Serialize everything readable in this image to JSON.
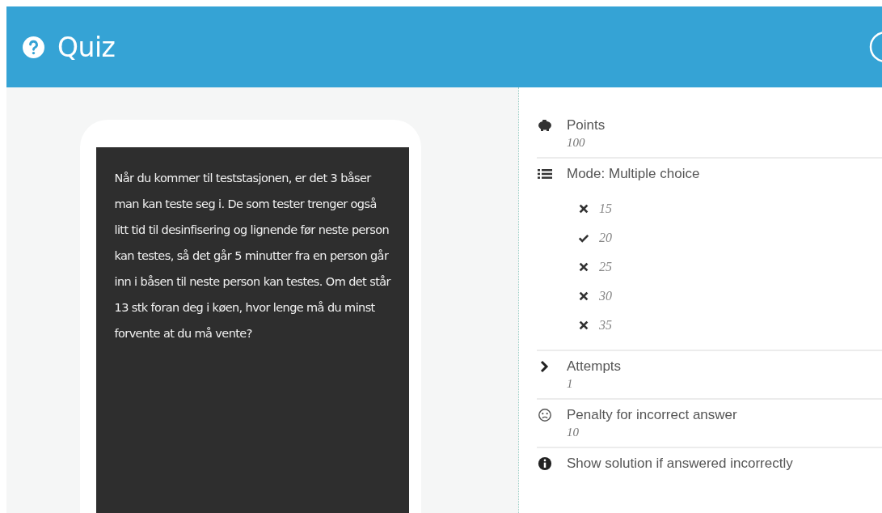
{
  "header": {
    "title": "Quiz"
  },
  "question": {
    "text": "Når du kommer til teststasjonen, er det 3 båser man kan teste seg i. De som tester trenger også litt tid til desinfisering og lignende før neste person kan testes, så det går 5 minutter fra en person går inn i båsen til neste person kan testes. Om det står 13 stk foran deg i køen, hvor lenge må du minst forvente at du må vente?"
  },
  "settings": [
    {
      "kind": "points",
      "label": "Points",
      "value": "100"
    },
    {
      "kind": "mode",
      "label": "Mode: Multiple choice",
      "options": [
        {
          "text": "15",
          "correct": false
        },
        {
          "text": "20",
          "correct": true
        },
        {
          "text": "25",
          "correct": false
        },
        {
          "text": "30",
          "correct": false
        },
        {
          "text": "35",
          "correct": false
        }
      ]
    },
    {
      "kind": "attempts",
      "label": "Attempts",
      "value": "1"
    },
    {
      "kind": "penalty",
      "label": "Penalty for incorrect answer",
      "value": "10"
    },
    {
      "kind": "solution",
      "label": "Show solution if answered incorrectly"
    }
  ]
}
